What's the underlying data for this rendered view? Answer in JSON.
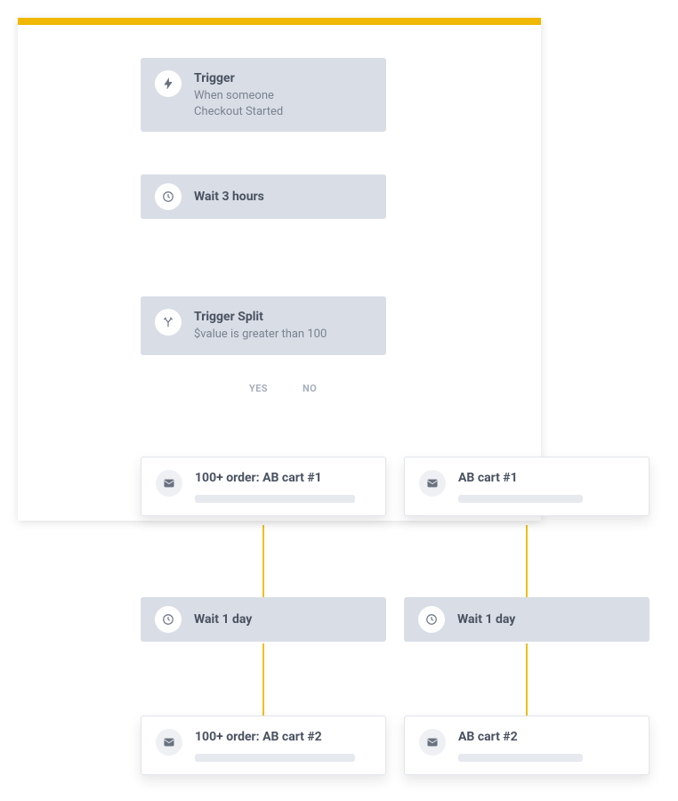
{
  "colors": {
    "accent": "#f0b800",
    "card": "#d9dee6",
    "text": "#4a5261",
    "muted": "#7a828f",
    "label": "#a7afbb"
  },
  "trigger": {
    "title": "Trigger",
    "line1": "When someone",
    "line2": "Checkout Started"
  },
  "wait_top": {
    "title": "Wait 3 hours"
  },
  "split": {
    "title": "Trigger Split",
    "condition": "$value is greater than 100",
    "yes_label": "YES",
    "no_label": "NO"
  },
  "left": {
    "email1": {
      "title": "100+ order: AB cart #1"
    },
    "wait": {
      "title": "Wait 1 day"
    },
    "email2": {
      "title": "100+ order: AB cart #2"
    }
  },
  "right": {
    "email1": {
      "title": "AB cart #1"
    },
    "wait": {
      "title": "Wait 1 day"
    },
    "email2": {
      "title": "AB cart #2"
    }
  }
}
